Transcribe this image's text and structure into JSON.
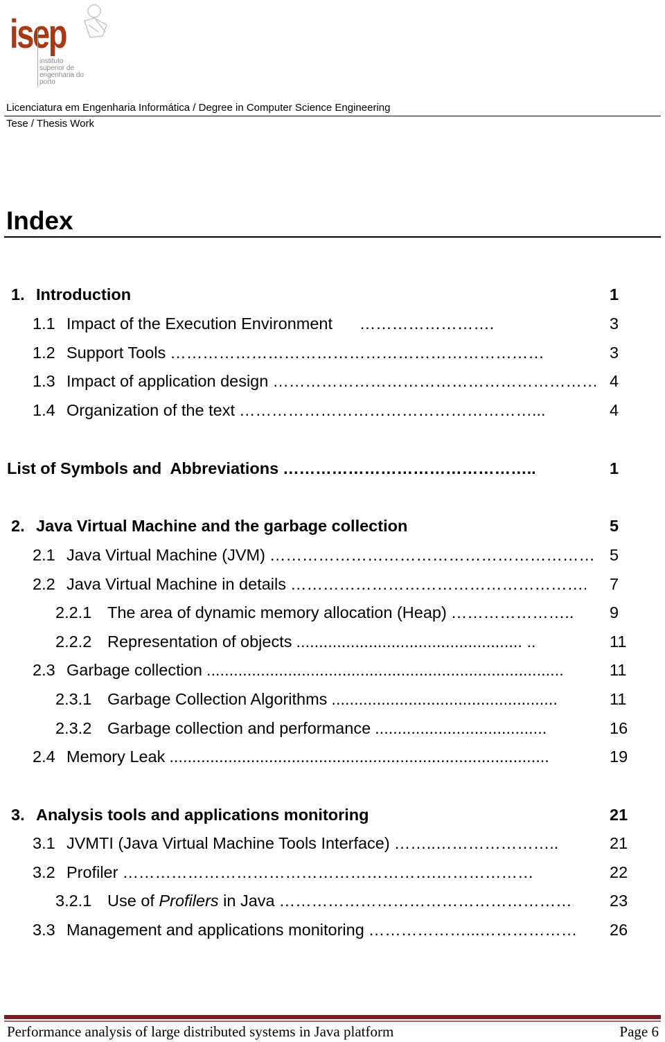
{
  "logo": {
    "word": "isep",
    "subtitle": [
      "instituto",
      "superior de",
      "engenharia do",
      "porto"
    ],
    "color": "#a63a17"
  },
  "header": {
    "line1": "Licenciatura em Engenharia Informática / Degree in Computer Science Engineering",
    "line2": "Tese / Thesis Work"
  },
  "title": "Index",
  "toc": [
    {
      "num": "1.",
      "title": "Introduction",
      "leader": "",
      "page": "1",
      "level": 1,
      "bold": true
    },
    {
      "num": "1.1",
      "title": "Impact of the Execution Environment",
      "leader": "     …………………….",
      "page": "3",
      "level": 2
    },
    {
      "num": "1.2",
      "title": "Support Tools",
      "leader": "……………………………………………………………",
      "page": "3",
      "level": 2
    },
    {
      "num": "1.3",
      "title": "Impact of application design",
      "leader": "……………………………………………………",
      "page": "4",
      "level": 2
    },
    {
      "num": "1.4",
      "title": "Organization of the text",
      "leader": "………………………………………………...",
      "page": "4",
      "level": 2
    },
    {
      "num": "",
      "title": "List of Symbols and  Abbreviations",
      "leader": "………………………………………..",
      "page": "1",
      "level": 0,
      "bold": true
    },
    {
      "num": "2.",
      "title": "Java Virtual Machine and the garbage collection",
      "leader": "",
      "page": "5",
      "level": 1,
      "bold": true
    },
    {
      "num": "2.1",
      "title": "Java Virtual Machine (JVM)",
      "leader": "……………………………………………………",
      "page": "5",
      "level": 2
    },
    {
      "num": "2.2",
      "title": "Java Virtual Machine in details",
      "leader": "……………………………………………….",
      "page": "7",
      "level": 2
    },
    {
      "num": "2.2.1",
      "title": "The area of dynamic memory allocation (Heap)",
      "leader": "…………………..",
      "page": "9",
      "level": 3
    },
    {
      "num": "2.2.2",
      "title": "Representation of objects",
      "leader": ".................................................. ..",
      "page": "11",
      "level": 3
    },
    {
      "num": "2.3",
      "title": "Garbage collection",
      "leader": "...............................................................................",
      "page": "11",
      "level": 2
    },
    {
      "num": "2.3.1",
      "title": "Garbage Collection Algorithms",
      "leader": "..................................................",
      "page": "11",
      "level": 3
    },
    {
      "num": "2.3.2",
      "title": "Garbage collection and performance",
      "leader": "......................................",
      "page": "16",
      "level": 3
    },
    {
      "num": "2.4",
      "title": "Memory Leak",
      "leader": "....................................................................................",
      "page": "19",
      "level": 2
    },
    {
      "num": "3.",
      "title": "Analysis tools and applications monitoring",
      "leader": "",
      "page": "21",
      "level": 1,
      "bold": true
    },
    {
      "num": "3.1",
      "title": "JVMTI (Java Virtual Machine Tools Interface)",
      "leader": "……..…………………..",
      "page": "21",
      "level": 2
    },
    {
      "num": "3.2",
      "title": "Profiler",
      "leader": "………………………………………………….………………",
      "page": "22",
      "level": 2
    },
    {
      "num": "3.2.1",
      "title_pre": "Use of ",
      "title_em": "Profilers",
      "title_post": " in Java",
      "leader": "……………………………………………….",
      "page": "23",
      "level": 3
    },
    {
      "num": "3.3",
      "title": "Management and applications monitoring",
      "leader": "………………...………………",
      "page": "26",
      "level": 2
    }
  ],
  "footer": {
    "left": "Performance analysis of large distributed systems in Java platform",
    "right": "Page 6",
    "rule_color": "#7a1f1f"
  }
}
